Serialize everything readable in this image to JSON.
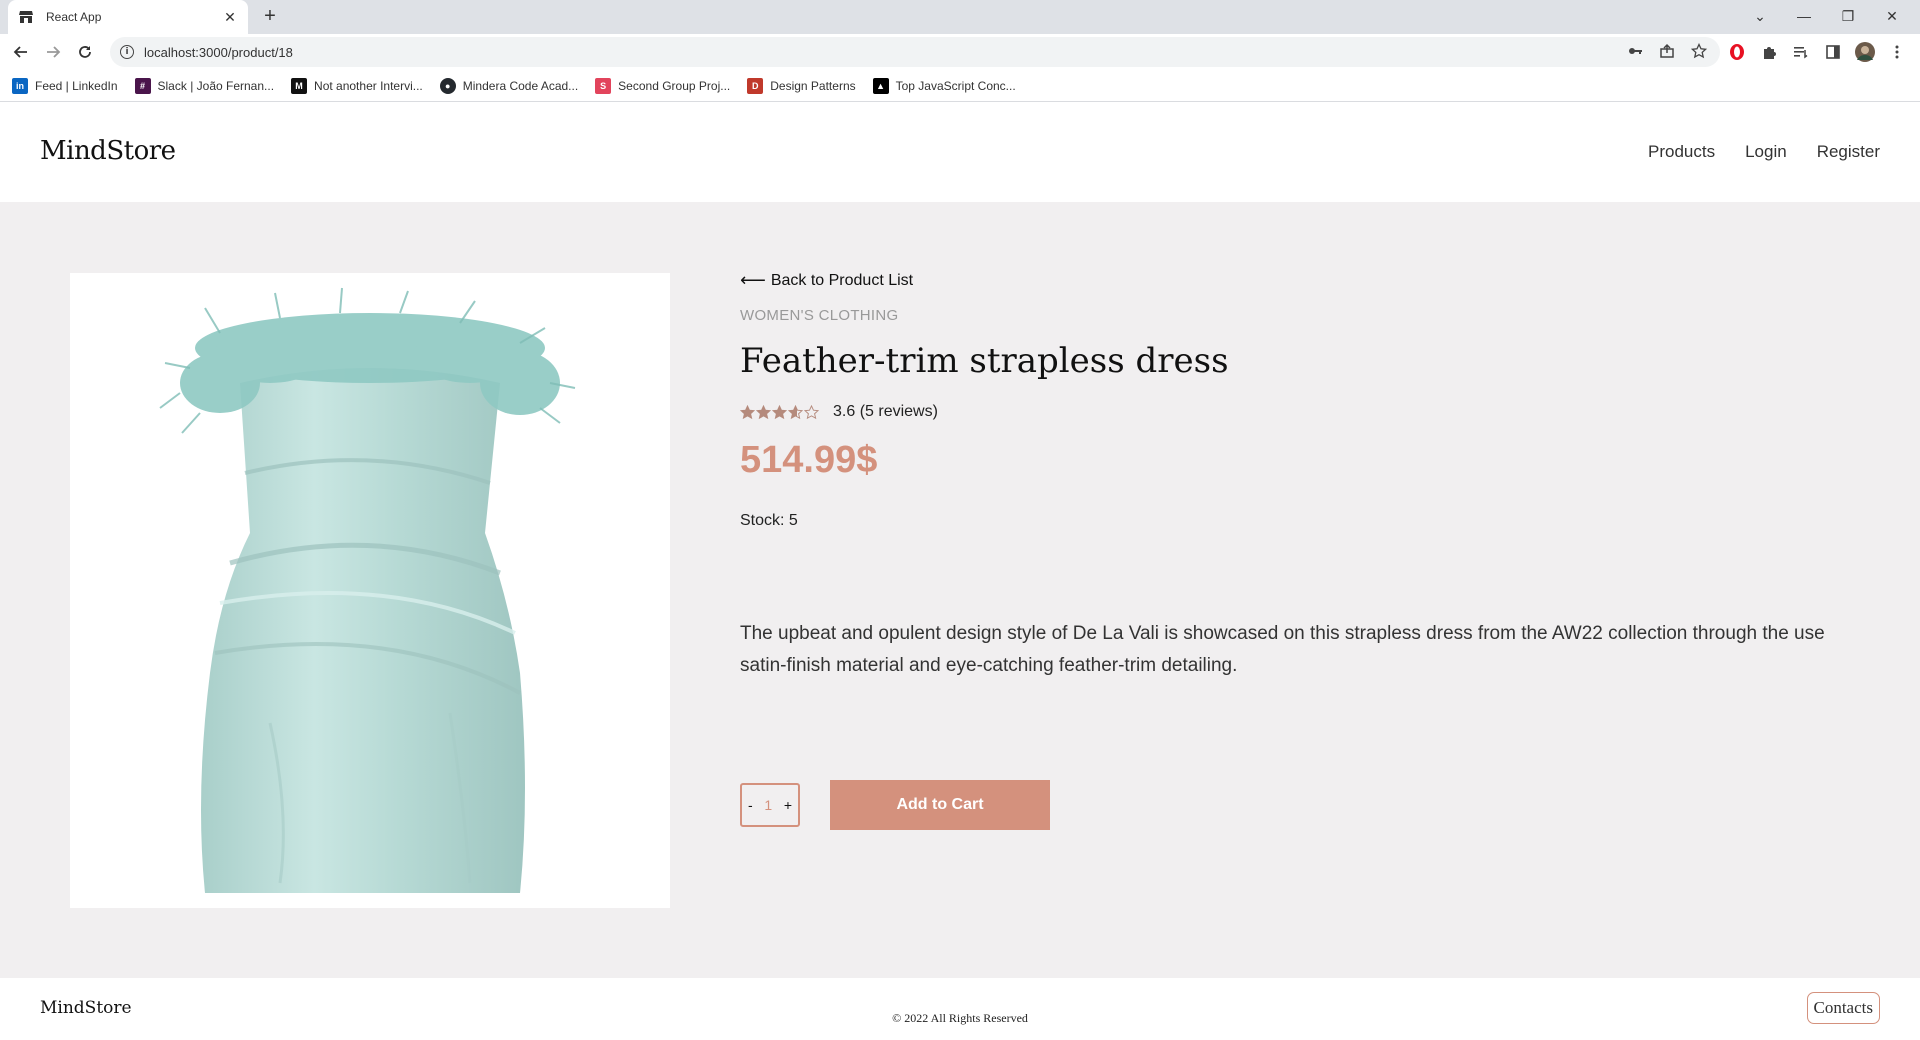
{
  "browser": {
    "tab_title": "React App",
    "tab_close": "✕",
    "new_tab": "+",
    "url": "localhost:3000/product/18",
    "window_controls": [
      "⌄",
      "—",
      "❐",
      "✕"
    ],
    "bookmarks": [
      {
        "label": "Feed | LinkedIn",
        "icon": "linkedin-icon",
        "color": "#0a66c2",
        "glyph": "in"
      },
      {
        "label": "Slack | João Fernan...",
        "icon": "slack-icon",
        "color": "#4a154b",
        "glyph": "#"
      },
      {
        "label": "Not another Intervi...",
        "icon": "medium-icon",
        "color": "#111111",
        "glyph": "M"
      },
      {
        "label": "Mindera Code Acad...",
        "icon": "github-icon",
        "color": "#24292e",
        "glyph": "●"
      },
      {
        "label": "Second Group Proj...",
        "icon": "scrum-icon",
        "color": "#e2445c",
        "glyph": "S"
      },
      {
        "label": "Design Patterns",
        "icon": "design-patterns-icon",
        "color": "#c0392b",
        "glyph": "D"
      },
      {
        "label": "Top JavaScript Conc...",
        "icon": "vercel-icon",
        "color": "#000000",
        "glyph": "▲"
      }
    ]
  },
  "header": {
    "logo": "MindStore",
    "nav": {
      "products": "Products",
      "login": "Login",
      "register": "Register"
    }
  },
  "product": {
    "back_label": "Back to Product List",
    "back_arrow": "⟵",
    "category": "WOMEN'S CLOTHING",
    "title": "Feather-trim strapless dress",
    "rating": 3.6,
    "rating_text": "3.6 (5 reviews)",
    "price": "514.99$",
    "stock": "Stock: 5",
    "description": "The upbeat and opulent design style of De La Vali is showcased on this strapless dress from the AW22 collection through the use satin-finish material and eye-catching feather-trim detailing.",
    "quantity": {
      "minus": "-",
      "value": "1",
      "plus": "+"
    },
    "add_to_cart": "Add to Cart"
  },
  "footer": {
    "logo": "MindStore",
    "copyright": "© 2022 All Rights Reserved",
    "contacts": "Contacts"
  },
  "colors": {
    "accent": "#d4917d",
    "page_bg": "#f1eff0",
    "dress": "#b9dcd8"
  }
}
